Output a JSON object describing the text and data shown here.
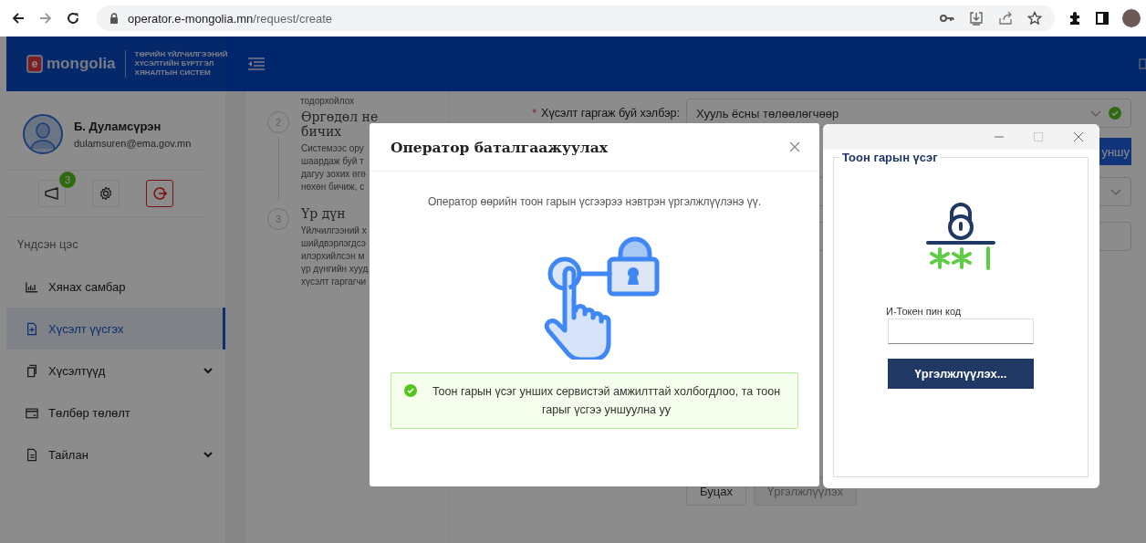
{
  "browser": {
    "url_host": "operator.e-mongolia.mn",
    "url_path": "/request/create"
  },
  "header": {
    "logo_mark": "e",
    "logo_text": "mongolia",
    "system_title": [
      "ТӨРИЙН ҮЙЛЧИЛГЭЭНИЙ",
      "ХҮСЭЛТИЙН БҮРТГЭЛ",
      "ХЯНАЛТЫН СИСТЕМ"
    ]
  },
  "user": {
    "name": "Б. Дуламсүрэн",
    "email": "dulamsuren@ema.gov.mn",
    "notification_count": "3"
  },
  "sidebar": {
    "section_title": "Үндсэн цэс",
    "items": [
      {
        "label": "Хянах самбар",
        "selected": false,
        "has_submenu": false
      },
      {
        "label": "Хүсэлт үүсгэх",
        "selected": true,
        "has_submenu": false
      },
      {
        "label": "Хүсэлтүүд",
        "selected": false,
        "has_submenu": true
      },
      {
        "label": "Төлбөр төлөлт",
        "selected": false,
        "has_submenu": false
      },
      {
        "label": "Тайлан",
        "selected": false,
        "has_submenu": true
      }
    ]
  },
  "steps": {
    "previous_tail": "тодорхойлох",
    "items": [
      {
        "number": "2",
        "title_lines": [
          "Өргөдөл не",
          "бичих"
        ],
        "lines": [
          "Системээс ору",
          "шаардаж буй т",
          "дагуу зохих өгө",
          "нөхөн бичиж, с"
        ]
      },
      {
        "number": "3",
        "title_lines": [
          "Үр дүн"
        ],
        "lines": [
          "Үйлчилгээний х",
          "шийдвэрлэгдсэ",
          "илэрхийлсэн м",
          "үр дүнгийн хууд",
          "хүсэлт гаргагчи"
        ]
      }
    ]
  },
  "form": {
    "fields": [
      {
        "kind": "select",
        "required_mark": "*",
        "label": "Хүсэлт гаргаж буй хэлбэр:",
        "value": "Хууль ёсны төлөөлөгчөөр",
        "valid": true
      },
      {
        "kind": "button",
        "label": "уншу"
      },
      {
        "kind": "select"
      },
      {
        "kind": "input"
      }
    ],
    "buttons": [
      {
        "label": "Буцах",
        "disabled": false
      },
      {
        "label": "Үргэлжлүүлэх",
        "disabled": true
      }
    ]
  },
  "modal": {
    "title": "Оператор баталгаажуулах",
    "message": "Оператор өөрийн тоон гарын үсгээрээ нэвтрэн үргэлжлүүлэнэ үү.",
    "alert": {
      "text": "Тоон гарын үсэг унших сервистэй амжилттай холбогдлоо, та тоон гарыг үсгээ уншуулна уу"
    }
  },
  "signer_window": {
    "group_title": "Тоон гарын үсэг",
    "pin_label": "И-Токен пин код",
    "button": "Үргэлжлүүлэх..."
  }
}
